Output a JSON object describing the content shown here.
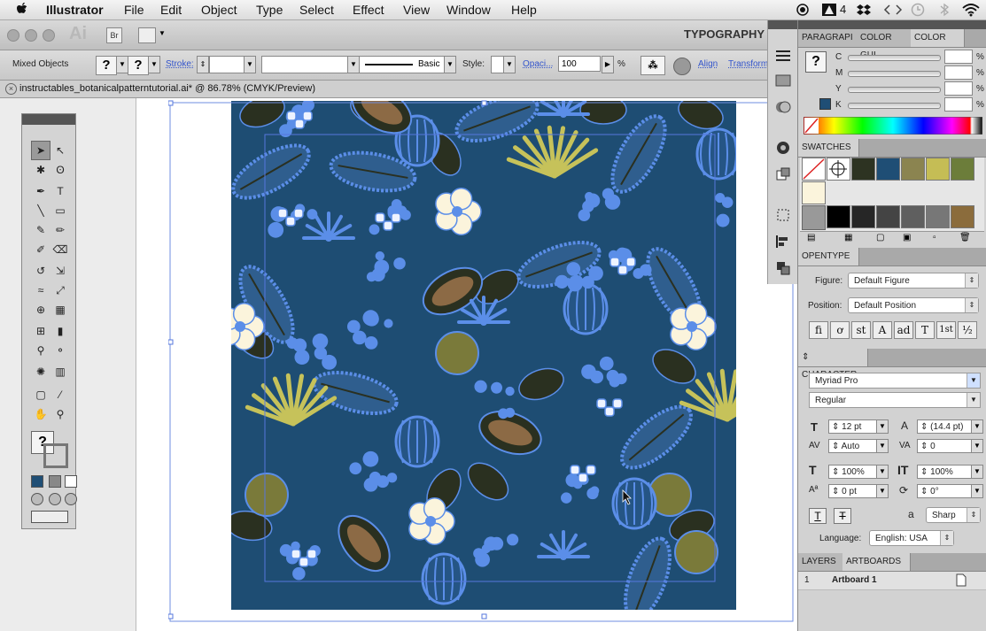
{
  "menubar": {
    "app": "Illustrator",
    "items": [
      "File",
      "Edit",
      "Object",
      "Type",
      "Select",
      "Effect",
      "View",
      "Window",
      "Help"
    ],
    "status": {
      "adobe_badge": "4"
    }
  },
  "appbar": {
    "logo": "Ai",
    "bridge": "Br",
    "workspace": "TYPOGRAPHY"
  },
  "control": {
    "selection": "Mixed Objects",
    "stroke_label": "Stroke:",
    "brush_label": "Basic",
    "style_label": "Style:",
    "opacity_label": "Opaci...",
    "opacity_value": "100",
    "opacity_unit": "%",
    "align_label": "Align",
    "transform_label": "Transform",
    "q_glyph": "?"
  },
  "document": {
    "tab_title": "instructables_botanicalpatterntutorial.ai* @ 86.78% (CMYK/Preview)"
  },
  "panels": {
    "color": {
      "tabs": [
        "PARAGRAPH",
        "COLOR GUIDE",
        "COLOR"
      ],
      "tab_labels": [
        "PARAGRAPI",
        "COLOR GUI",
        "COLOR"
      ],
      "channels": [
        "C",
        "M",
        "Y",
        "K"
      ],
      "unit": "%"
    },
    "swatches": {
      "title": "SWATCHES",
      "row1": [
        "#2d3322",
        "#1f4e75",
        "#8b8450",
        "#c5bd55",
        "#6c7d3a"
      ],
      "row3": [
        "#000000",
        "#262626",
        "#444444",
        "#5f5f5f",
        "#777777",
        "#8b6c3c"
      ]
    },
    "opentype": {
      "title": "OPENTYPE",
      "figure_label": "Figure:",
      "figure_value": "Default Figure",
      "position_label": "Position:",
      "position_value": "Default Position",
      "buttons": [
        "ﬁ",
        "ơ",
        "st",
        "A",
        "ad",
        "T",
        "1st",
        "½"
      ]
    },
    "character": {
      "title": "CHARACTER",
      "font": "Myriad Pro",
      "style": "Regular",
      "size": "12 pt",
      "leading": "(14.4 pt)",
      "kerning": "Auto",
      "tracking": "0",
      "vscale": "100%",
      "hscale": "100%",
      "baseline": "0 pt",
      "rotation": "0°",
      "aa_label": "a",
      "aa_value": "Sharp",
      "language_label": "Language:",
      "language_value": "English: USA"
    },
    "layers": {
      "tabs": [
        "LAYERS",
        "ARTBOARDS"
      ],
      "row_index": "1",
      "row_name": "Artboard 1"
    }
  },
  "colors": {
    "pattern_bg": "#1e4d73",
    "blue": "#5b8ee8",
    "dark": "#2a3020",
    "olive": "#7a7a3a",
    "cream": "#fbf4dc",
    "yellow": "#c6c25a",
    "brown": "#8c6a45",
    "selection": "#5577dd"
  }
}
